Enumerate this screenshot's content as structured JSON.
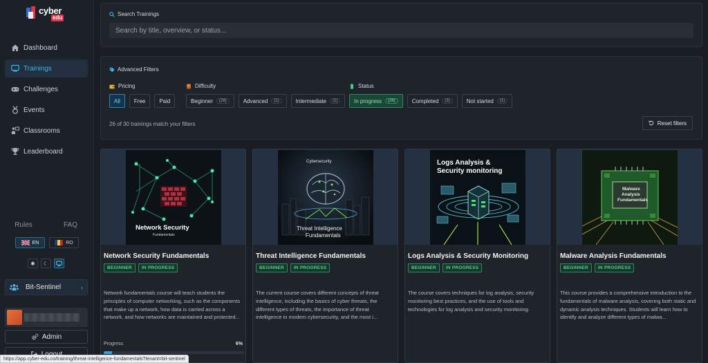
{
  "brand": {
    "name": "cyber",
    "tag": "edu"
  },
  "nav": [
    {
      "label": "Dashboard",
      "icon": "home-icon"
    },
    {
      "label": "Trainings",
      "icon": "monitor-icon",
      "active": true
    },
    {
      "label": "Challenges",
      "icon": "gamepad-icon"
    },
    {
      "label": "Events",
      "icon": "medal-icon"
    },
    {
      "label": "Classrooms",
      "icon": "classroom-icon"
    },
    {
      "label": "Leaderboard",
      "icon": "trophy-icon"
    }
  ],
  "footer_links": {
    "rules": "Rules",
    "faq": "FAQ"
  },
  "languages": [
    {
      "code": "EN",
      "active": true
    },
    {
      "code": "RO",
      "active": false
    }
  ],
  "team": {
    "name": "Bit-Sentinel"
  },
  "buttons": {
    "admin": "Admin",
    "logout": "Logout"
  },
  "search": {
    "title": "Search Trainings",
    "placeholder": "Search by title, overview, or status..."
  },
  "filters": {
    "title": "Advanced Filters",
    "pricing": {
      "label": "Pricing",
      "options": [
        "All",
        "Free",
        "Paid"
      ]
    },
    "difficulty": {
      "label": "Difficulty",
      "options": [
        {
          "label": "Beginner",
          "count": "(28)"
        },
        {
          "label": "Advanced",
          "count": "(1)"
        },
        {
          "label": "Intermediate",
          "count": "(1)"
        }
      ]
    },
    "status": {
      "label": "Status",
      "options": [
        {
          "label": "In progress",
          "count": "(26)"
        },
        {
          "label": "Completed",
          "count": "(3)"
        },
        {
          "label": "Not started",
          "count": "(1)"
        }
      ]
    },
    "match_text": "26 of 30 trainings match your filters",
    "reset_label": "Reset filters"
  },
  "cards": [
    {
      "title": "Network Security Fundamentals",
      "thumb_title": "Network Security",
      "thumb_sub": "Fundamentals",
      "badges": [
        "BEGINNER",
        "IN PROGRESS"
      ],
      "description": "Network fundamentals course will teach students the principles of computer networking, such as the components that make up a network, how data is carried across a network, and how networks are maintained and protected...",
      "progress_label": "Progress",
      "progress_text": "6%",
      "progress": 6
    },
    {
      "title": "Threat Intelligence Fundamentals",
      "thumb_head": "Cybersecurity",
      "thumb_title": "Threat Intelligence",
      "thumb_sub": "Fundamentals",
      "badges": [
        "BEGINNER",
        "IN PROGRESS"
      ],
      "description": "The current course covers different concepts of threat intelligence, including the basics of cyber threats, the different types of threats, the importance of threat intelligence in modern cybersecurity, and the most i..."
    },
    {
      "title": "Logs Analysis & Security Monitoring",
      "thumb_title": "Logs Analysis &",
      "thumb_sub": "Security monitoring",
      "badges": [
        "BEGINNER",
        "IN PROGRESS"
      ],
      "description": "The course covers techniques for log analysis, security monitoring best practices, and the use of tools and technologies for log analysis and security monitoring."
    },
    {
      "title": "Malware Analysis Fundamentals",
      "thumb_title": "Malware",
      "thumb_title2": "Analysis",
      "thumb_sub": "Fundamentals",
      "badges": [
        "BEGINNER",
        "IN PROGRESS"
      ],
      "description": "This course provides a comprehensive introduction to the fundamentals of malware analysis, covering both static and dynamic analysis techniques. Students will learn how to identify and analyze different types of malwa..."
    }
  ],
  "status_url": "https://app.cyber-edu.co/training/threat-intelligence-fundamentals?tenant=bit-sentinel"
}
